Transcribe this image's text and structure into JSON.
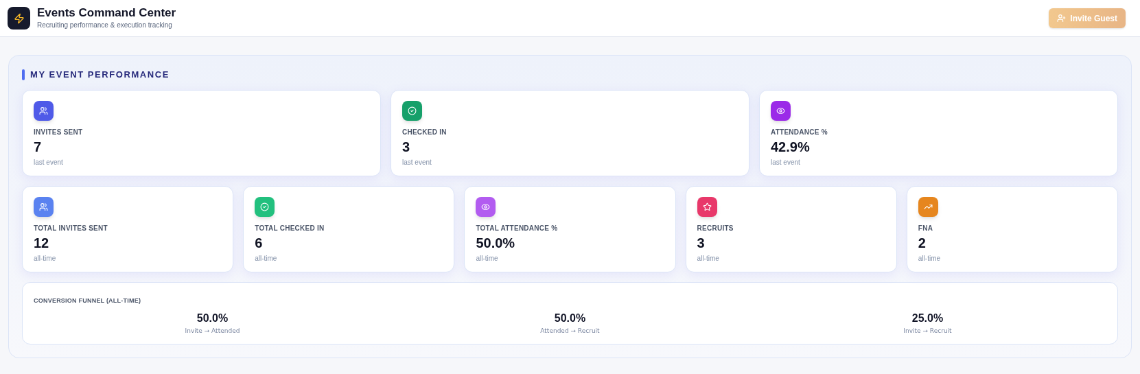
{
  "header": {
    "title": "Events Command Center",
    "subtitle": "Recruiting performance & execution tracking",
    "invite_button": {
      "label": "Invite Guest",
      "disabled": true
    }
  },
  "section": {
    "title": "MY EVENT PERFORMANCE",
    "last_event_cards": [
      {
        "kind": "users",
        "color": "#4f5ae8",
        "label": "INVITES SENT",
        "value": "7",
        "note": "last event"
      },
      {
        "kind": "check",
        "color": "#16a06a",
        "label": "CHECKED IN",
        "value": "3",
        "note": "last event"
      },
      {
        "kind": "eye",
        "color": "#9b2ae8",
        "label": "ATTENDANCE %",
        "value": "42.9%",
        "note": "last event"
      }
    ],
    "all_time_cards": [
      {
        "kind": "users",
        "color": "#5a82f0",
        "label": "TOTAL INVITES SENT",
        "value": "12",
        "note": "all-time"
      },
      {
        "kind": "check",
        "color": "#22c07e",
        "label": "TOTAL CHECKED IN",
        "value": "6",
        "note": "all-time"
      },
      {
        "kind": "eye",
        "color": "#b25cf0",
        "label": "TOTAL ATTENDANCE %",
        "value": "50.0%",
        "note": "all-time"
      },
      {
        "kind": "star",
        "color": "#e8386a",
        "label": "RECRUITS",
        "value": "3",
        "note": "all-time"
      },
      {
        "kind": "trend",
        "color": "#e6861e",
        "label": "FNA",
        "value": "2",
        "note": "all-time"
      }
    ],
    "funnel": {
      "title": "CONVERSION FUNNEL (ALL-TIME)",
      "steps": [
        {
          "value": "50.0%",
          "label": "Invite → Attended"
        },
        {
          "value": "50.0%",
          "label": "Attended → Recruit"
        },
        {
          "value": "25.0%",
          "label": "Invite → Recruit"
        }
      ]
    }
  }
}
